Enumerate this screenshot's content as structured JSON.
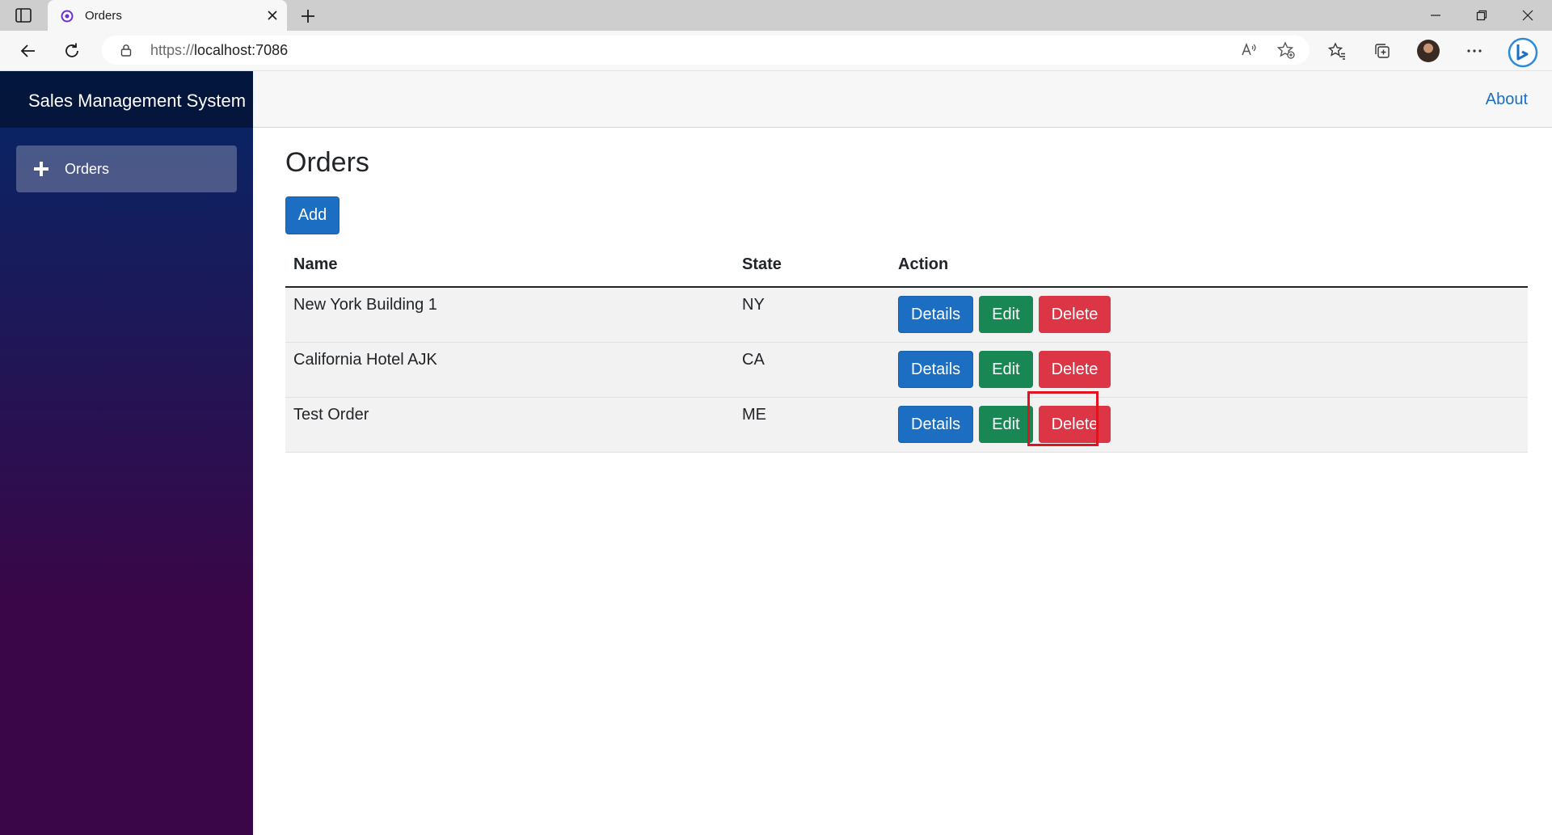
{
  "browser": {
    "tab_title": "Orders",
    "url_prefix": "https://",
    "url_host": "localhost:7086"
  },
  "app": {
    "brand": "Sales Management System",
    "nav_items": [
      {
        "label": "Orders",
        "icon": "plus-icon"
      }
    ],
    "about_label": "About"
  },
  "page": {
    "title": "Orders",
    "add_label": "Add",
    "columns": [
      "Name",
      "State",
      "Action"
    ],
    "rows": [
      {
        "name": "New York Building 1",
        "state": "NY"
      },
      {
        "name": "California Hotel AJK",
        "state": "CA"
      },
      {
        "name": "Test Order",
        "state": "ME"
      }
    ],
    "actions": {
      "details": "Details",
      "edit": "Edit",
      "delete": "Delete"
    }
  },
  "colors": {
    "primary": "#1b6ec2",
    "success": "#198754",
    "danger": "#dc3545",
    "highlight": "#e0141e",
    "sidebar_top": "#052767",
    "sidebar_bottom": "#3a0647"
  }
}
